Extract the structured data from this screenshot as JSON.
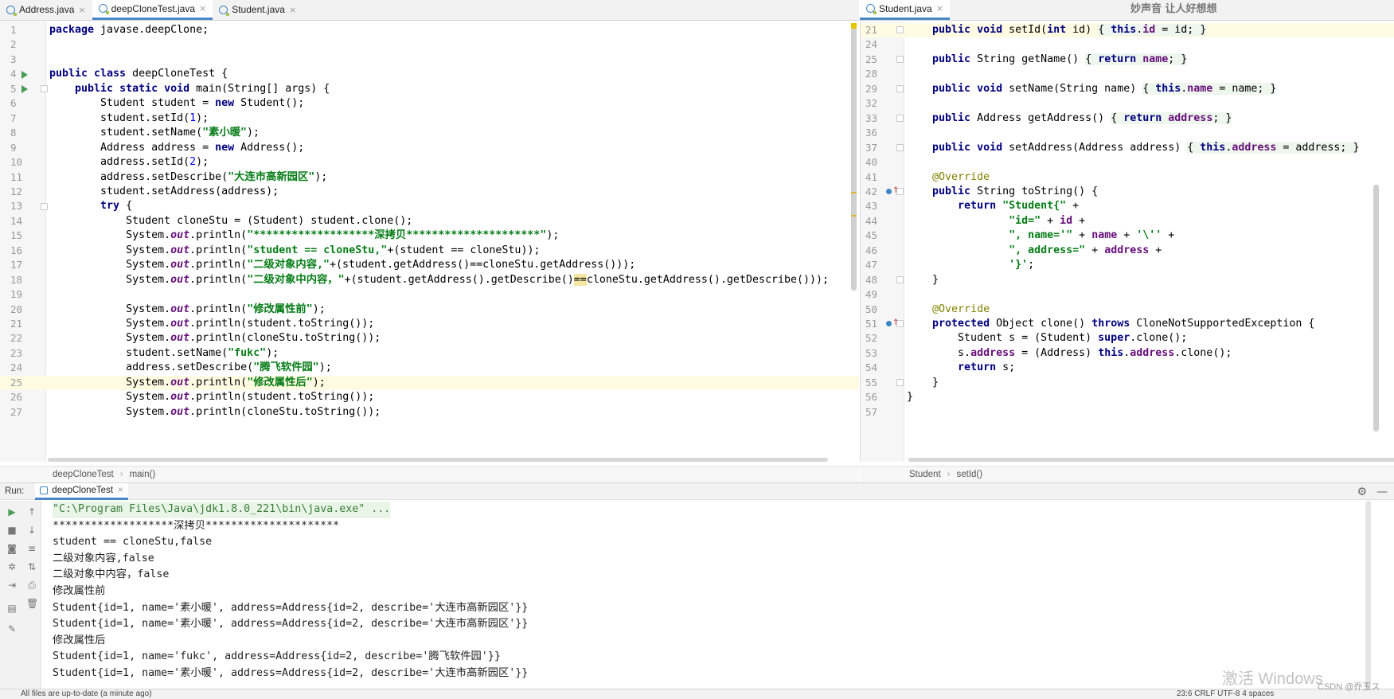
{
  "left_tabs": [
    {
      "label": "Address.java",
      "active": false
    },
    {
      "label": "deepCloneTest.java",
      "active": true
    },
    {
      "label": "Student.java",
      "active": false
    }
  ],
  "right_tabs": [
    {
      "label": "Student.java",
      "active": true
    }
  ],
  "overlay_text": "妙声音 让人好想想",
  "left_lines": [
    {
      "n": "1",
      "html": "<span class=\"kw\">package</span> javase.deepClone;"
    },
    {
      "n": "2",
      "html": ""
    },
    {
      "n": "3",
      "html": ""
    },
    {
      "n": "4",
      "html": "<span class=\"kw\">public class</span> deepCloneTest {"
    },
    {
      "n": "5",
      "html": "    <span class=\"kw\">public static void</span> main(String[] args) {"
    },
    {
      "n": "6",
      "html": "        Student student = <span class=\"kw\">new</span> Student();"
    },
    {
      "n": "7",
      "html": "        student.setId(<span class=\"num\">1</span>);"
    },
    {
      "n": "8",
      "html": "        student.setName(<span class=\"str\">\"素小暖\"</span>);"
    },
    {
      "n": "9",
      "html": "        Address address = <span class=\"kw\">new</span> Address();"
    },
    {
      "n": "10",
      "html": "        address.setId(<span class=\"num\">2</span>);"
    },
    {
      "n": "11",
      "html": "        address.setDescribe(<span class=\"str\">\"大连市高新园区\"</span>);"
    },
    {
      "n": "12",
      "html": "        student.setAddress(address);"
    },
    {
      "n": "13",
      "html": "        <span class=\"kw\">try</span> {"
    },
    {
      "n": "14",
      "html": "            Student cloneStu = (Student) student.clone();"
    },
    {
      "n": "15",
      "html": "            System.<span class=\"stat\">out</span>.println(<span class=\"str\">\"*******************深拷贝*********************\"</span>);"
    },
    {
      "n": "16",
      "html": "            System.<span class=\"stat\">out</span>.println(<span class=\"str\">\"student == cloneStu,\"</span>+(student == cloneStu));"
    },
    {
      "n": "17",
      "html": "            System.<span class=\"stat\">out</span>.println(<span class=\"str\">\"二级对象内容,\"</span>+(student.getAddress()==cloneStu.getAddress()));"
    },
    {
      "n": "18",
      "html": "            System.<span class=\"stat\">out</span>.println(<span class=\"str\">\"二级对象中内容，\"</span>+(student.getAddress().getDescribe()<span class=\"hlmatch\">==</span>cloneStu.getAddress().getDescribe()));"
    },
    {
      "n": "19",
      "html": ""
    },
    {
      "n": "20",
      "html": "            System.<span class=\"stat\">out</span>.println(<span class=\"str\">\"修改属性前\"</span>);"
    },
    {
      "n": "21",
      "html": "            System.<span class=\"stat\">out</span>.println(student.toString());"
    },
    {
      "n": "22",
      "html": "            System.<span class=\"stat\">out</span>.println(cloneStu.toString());"
    },
    {
      "n": "23",
      "html": "            student.setName(<span class=\"str\">\"fukc\"</span>);"
    },
    {
      "n": "24",
      "html": "            address.setDescribe(<span class=\"str\">\"腾飞软件园\"</span>);"
    },
    {
      "n": "25",
      "html": "            System.<span class=\"stat\">out</span>.println(<span class=\"str\">\"修改属性后\"</span>);"
    },
    {
      "n": "26",
      "html": "            System.<span class=\"stat\">out</span>.println(student.toString());"
    },
    {
      "n": "27",
      "html": "            System.<span class=\"stat\">out</span>.println(cloneStu.toString());"
    }
  ],
  "right_lines": [
    {
      "n": "21",
      "html": "    <span class=\"kw\">public void</span> setId(<span class=\"kw\">int</span> id) <span class=\"fold\">{ <span class=\"kw\">this</span>.<span class=\"fld\">id</span> = id; }</span>"
    },
    {
      "n": "24",
      "html": ""
    },
    {
      "n": "25",
      "html": "    <span class=\"kw\">public</span> String getName() <span class=\"fold\">{ <span class=\"kw\">return</span> <span class=\"fld\">name</span>; }</span>"
    },
    {
      "n": "28",
      "html": ""
    },
    {
      "n": "29",
      "html": "    <span class=\"kw\">public void</span> setName(String name) <span class=\"fold\">{ <span class=\"kw\">this</span>.<span class=\"fld\">name</span> = name; }</span>"
    },
    {
      "n": "32",
      "html": ""
    },
    {
      "n": "33",
      "html": "    <span class=\"kw\">public</span> Address getAddress() <span class=\"fold\">{ <span class=\"kw\">return</span> <span class=\"fld\">address</span>; }</span>"
    },
    {
      "n": "36",
      "html": ""
    },
    {
      "n": "37",
      "html": "    <span class=\"kw\">public void</span> setAddress(Address address) <span class=\"fold\">{ <span class=\"kw\">this</span>.<span class=\"fld\">address</span> = address; }</span>"
    },
    {
      "n": "40",
      "html": ""
    },
    {
      "n": "41",
      "html": "    <span class=\"ann\">@Override</span>"
    },
    {
      "n": "42",
      "html": "    <span class=\"kw\">public</span> String toString() {"
    },
    {
      "n": "43",
      "html": "        <span class=\"kw\">return</span> <span class=\"str\">\"Student{\"</span> +"
    },
    {
      "n": "44",
      "html": "                <span class=\"str\">\"id=\"</span> + <span class=\"fld\">id</span> +"
    },
    {
      "n": "45",
      "html": "                <span class=\"str\">\", name='\"</span> + <span class=\"fld\">name</span> + <span class=\"str\">'\\''</span> +"
    },
    {
      "n": "46",
      "html": "                <span class=\"str\">\", address=\"</span> + <span class=\"fld\">address</span> +"
    },
    {
      "n": "47",
      "html": "                <span class=\"str\">'}'</span>;"
    },
    {
      "n": "48",
      "html": "    }"
    },
    {
      "n": "49",
      "html": ""
    },
    {
      "n": "50",
      "html": "    <span class=\"ann\">@Override</span>"
    },
    {
      "n": "51",
      "html": "    <span class=\"kw\">protected</span> Object clone() <span class=\"kw\">throws</span> CloneNotSupportedException {"
    },
    {
      "n": "52",
      "html": "        Student s = (Student) <span class=\"kw\">super</span>.clone();"
    },
    {
      "n": "53",
      "html": "        s.<span class=\"fld\">address</span> = (Address) <span class=\"kw\">this</span>.<span class=\"fld\">address</span>.clone();"
    },
    {
      "n": "54",
      "html": "        <span class=\"kw\">return</span> s;"
    },
    {
      "n": "55",
      "html": "    }"
    },
    {
      "n": "56",
      "html": "}"
    },
    {
      "n": "57",
      "html": ""
    }
  ],
  "left_breadcrumb": {
    "class": "deepCloneTest",
    "method": "main()"
  },
  "right_breadcrumb": {
    "class": "Student",
    "method": "setId()"
  },
  "run": {
    "label": "Run:",
    "tab": "deepCloneTest"
  },
  "console_lines": [
    "\"C:\\Program Files\\Java\\jdk1.8.0_221\\bin\\java.exe\" ...",
    "*******************深拷贝*********************",
    "student == cloneStu,false",
    "二级对象内容,false",
    "二级对象中内容，false",
    "修改属性前",
    "Student{id=1, name='素小暖', address=Address{id=2, describe='大连市高新园区'}}",
    "Student{id=1, name='素小暖', address=Address{id=2, describe='大连市高新园区'}}",
    "修改属性后",
    "Student{id=1, name='fukc', address=Address{id=2, describe='腾飞软件园'}}",
    "Student{id=1, name='素小暖', address=Address{id=2, describe='大连市高新园区'}}"
  ],
  "status": {
    "left": "All files are up-to-date (a minute ago)",
    "right": "23:6   CRLF   UTF-8   4 spaces"
  },
  "watermark": {
    "activate": "激活 Windows",
    "csdn": "CSDN @乔玉ス"
  },
  "icons": {
    "run": "run-icon",
    "tool": [
      "up-arrow-icon",
      "down-arrow-icon",
      "wrap-icon",
      "sort-icon",
      "print-icon",
      "trash-icon",
      "layout-icon",
      "pin-icon",
      "stop-icon",
      "camera-icon",
      "settings-icon"
    ]
  }
}
